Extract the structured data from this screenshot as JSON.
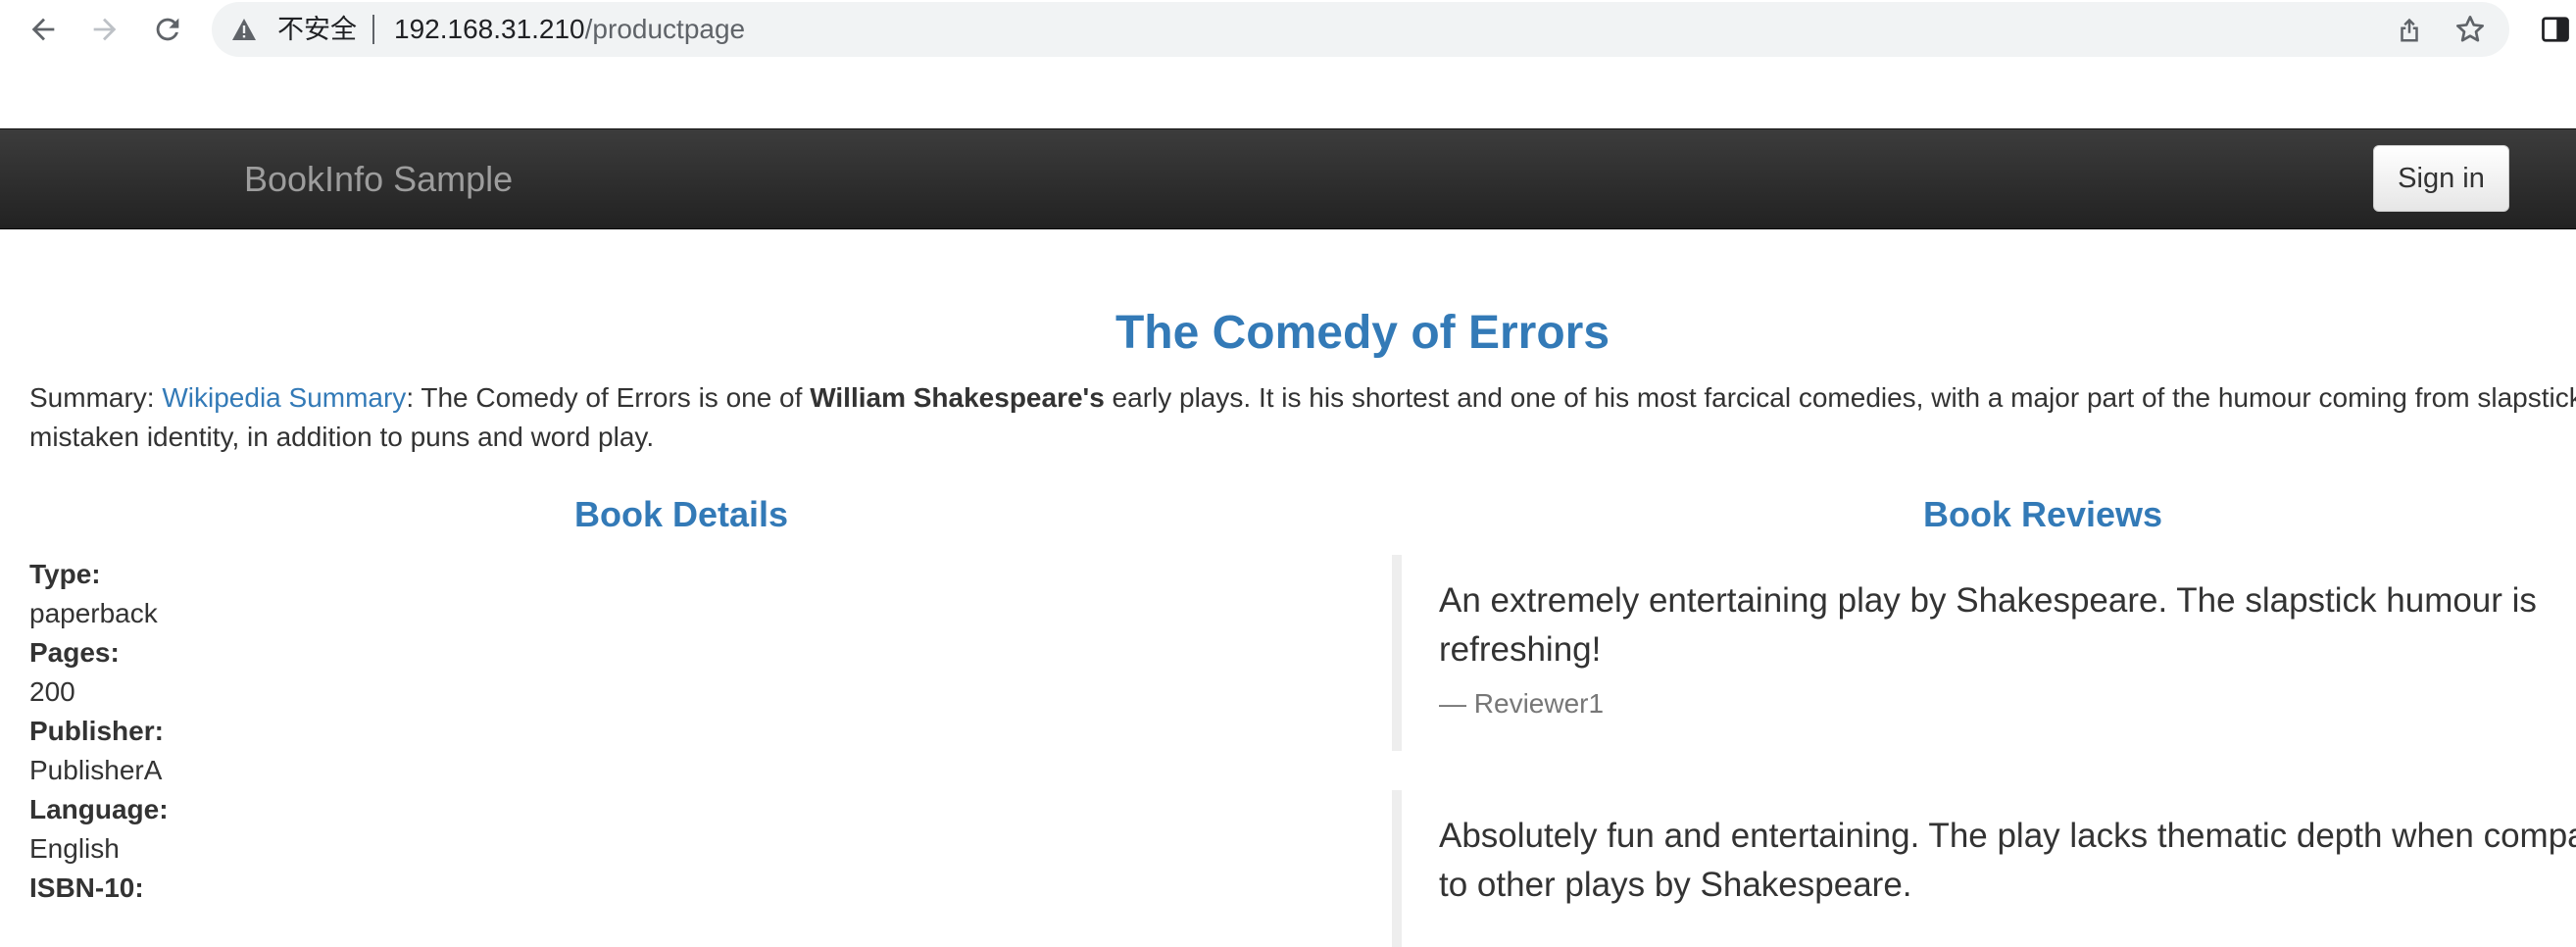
{
  "browser": {
    "security_label": "不安全",
    "url_host": "192.168.31.210",
    "url_path": "/productpage"
  },
  "navbar": {
    "brand": "BookInfo Sample",
    "sign_in_label": "Sign in"
  },
  "book": {
    "title": "The Comedy of Errors",
    "summary_prefix": "Summary: ",
    "summary_link": "Wikipedia Summary",
    "summary_part1": ": The Comedy of Errors is one of ",
    "summary_author": "William Shakespeare's",
    "summary_part2": " early plays. It is his shortest and one of his most farcical comedies, with a major part of the humour coming from slapstick and",
    "summary_line2": "mistaken identity, in addition to puns and word play."
  },
  "details": {
    "heading": "Book Details",
    "items": [
      {
        "label": "Type:",
        "value": "paperback"
      },
      {
        "label": "Pages:",
        "value": "200"
      },
      {
        "label": "Publisher:",
        "value": "PublisherA"
      },
      {
        "label": "Language:",
        "value": "English"
      },
      {
        "label": "ISBN-10:",
        "value": ""
      }
    ]
  },
  "reviews": {
    "heading": "Book Reviews",
    "items": [
      {
        "line1": "An extremely entertaining play by Shakespeare. The slapstick humour is",
        "line2": "refreshing!",
        "reviewer": "— Reviewer1"
      },
      {
        "line1": "Absolutely fun and entertaining. The play lacks thematic depth when compared",
        "line2": "to other plays by Shakespeare."
      }
    ]
  },
  "colors": {
    "link": "#337ab7",
    "navbar": "#222222",
    "brand": "#9d9d9d",
    "muted": "#777777"
  }
}
